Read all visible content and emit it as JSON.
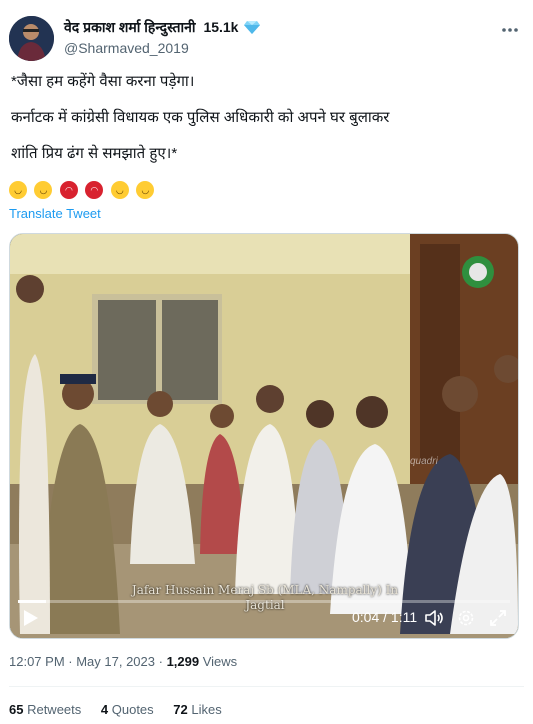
{
  "author": {
    "display_name": "वेद प्रकाश शर्मा हिन्दुस्तानी",
    "badge_count": "15.1k",
    "badge_icon": "diamond-icon",
    "handle": "@Sharmaved_2019"
  },
  "tweet": {
    "lines": [
      "*जैसा हम कहेंगे वैसा करना पड़ेगा।",
      "कर्नाटक में कांग्रेसी विधायक एक पुलिस अधिकारी को अपने घर बुलाकर",
      "शांति प्रिय ढंग से समझाते हुए।*"
    ],
    "emoji": [
      "joy-emoji",
      "joy-emoji",
      "angry-emoji",
      "angry-emoji",
      "joy-emoji",
      "joy-emoji"
    ],
    "translate_label": "Translate Tweet"
  },
  "video": {
    "caption_line1": "Jafar Hussain Meraj Sb (MLA, Nampally) In",
    "caption_line2": "Jagtial",
    "watermark": "quadri",
    "time": "0:04 / 1:11",
    "progress": 0.056
  },
  "meta": {
    "time": "12:07 PM",
    "sep1": " · ",
    "date": "May 17, 2023",
    "sep2": " · ",
    "views_count": "1,299",
    "views_label": " Views"
  },
  "stats": {
    "retweets_count": "65",
    "retweets_label": " Retweets",
    "quotes_count": "4",
    "quotes_label": " Quotes",
    "likes_count": "72",
    "likes_label": " Likes"
  },
  "colors": {
    "link": "#1d9bf0",
    "muted": "#536471",
    "text": "#0f1419"
  }
}
